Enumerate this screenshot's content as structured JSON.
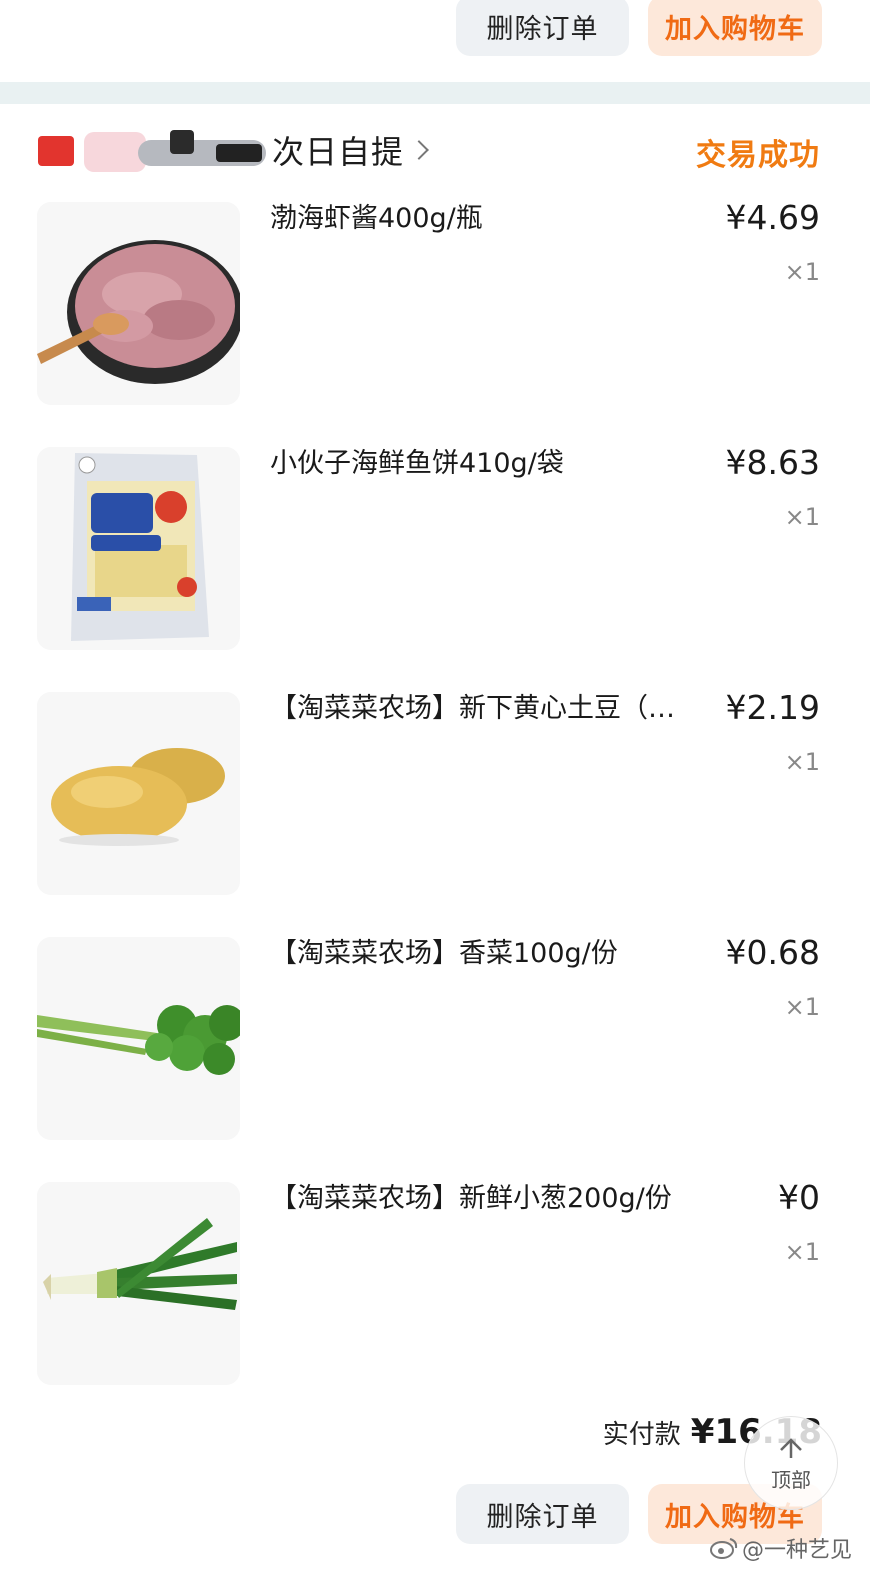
{
  "prev_order": {
    "delete_label": "删除订单",
    "add_cart_label": "加入购物车"
  },
  "order": {
    "shop_suffix": "次日自提",
    "status": "交易成功",
    "items": [
      {
        "title": "渤海虾酱400g/瓶",
        "price": "¥4.69",
        "qty": "×1",
        "image": "shrimp-paste"
      },
      {
        "title": "小伙子海鲜鱼饼410g/袋",
        "price": "¥8.63",
        "qty": "×1",
        "image": "fish-cake"
      },
      {
        "title": "【淘菜菜农场】新下黄心土豆（…",
        "price": "¥2.19",
        "qty": "×1",
        "image": "potato"
      },
      {
        "title": "【淘菜菜农场】香菜100g/份",
        "price": "¥0.68",
        "qty": "×1",
        "image": "coriander"
      },
      {
        "title": "【淘菜菜农场】新鲜小葱200g/份",
        "price": "¥0",
        "qty": "×1",
        "image": "scallion"
      }
    ],
    "paid_label": "实付款",
    "paid_value": "¥16.18",
    "delete_label": "删除订单",
    "add_cart_label": "加入购物车"
  },
  "fab": {
    "label": "顶部",
    "icon": "arrow-up-icon"
  },
  "watermark": {
    "text": "@一种艺见",
    "icon": "weibo-icon"
  },
  "colors": {
    "accent": "#f07b12",
    "button_orange_bg": "#fde8da",
    "button_gray_bg": "#eef1f4",
    "divider": "#e9f1f2"
  }
}
